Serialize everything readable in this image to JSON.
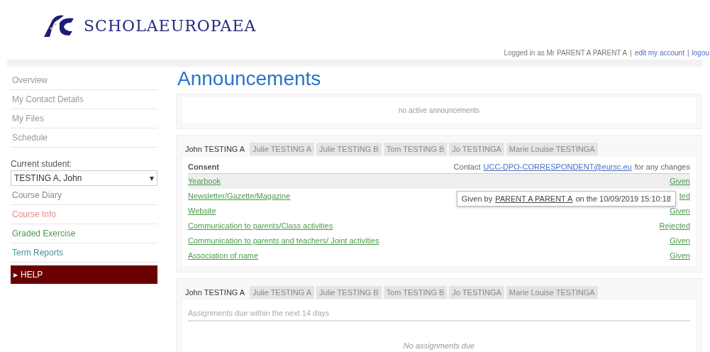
{
  "header": {
    "logo_text": "SCHOLAEUROPAEA",
    "logged_in": "Logged in as Mr PARENT A PARENT A",
    "separator_1": "|",
    "edit_account": "edit my account",
    "separator_2": "|",
    "logout": "logou"
  },
  "sidebar": {
    "items": [
      {
        "label": "Overview"
      },
      {
        "label": "My Contact Details"
      },
      {
        "label": "My Files"
      },
      {
        "label": "Schedule"
      }
    ],
    "student_label": "Current student:",
    "student_select": {
      "value": "TESTING A, John",
      "arrow": "▾"
    },
    "student_items": [
      {
        "label": "Course Diary",
        "color": "#8a8a8a"
      },
      {
        "label": "Course Info",
        "color": "#e88a8a"
      },
      {
        "label": "Graded Exercise",
        "color": "#4c9a4c"
      },
      {
        "label": "Term Reports",
        "color": "#4a8fa0"
      }
    ],
    "help": {
      "arrow": "▸",
      "label": "HELP"
    }
  },
  "page_title": "Announcements",
  "announcements": {
    "empty_text": "no active announcements"
  },
  "consent_panel": {
    "tabs": [
      {
        "label": "John TESTING A",
        "selected": true
      },
      {
        "label": "Julie TESTING A",
        "selected": false
      },
      {
        "label": "Julie TESTING B",
        "selected": false
      },
      {
        "label": "Tom TESTING B",
        "selected": false
      },
      {
        "label": "Jo TESTINGA",
        "selected": false
      },
      {
        "label": "Marie Louise TESTINGA",
        "selected": false
      }
    ],
    "heading": "Consent",
    "contact_prefix": "Contact",
    "contact_email": "UCC-DPO-CORRESPONDENT@eursc.eu",
    "contact_suffix": "for any changes",
    "rows": [
      {
        "item": "Yearbook",
        "status": "Given",
        "highlighted": true
      },
      {
        "item": "Newsletter/Gazette/Magazine",
        "status": "ted",
        "highlighted": false
      },
      {
        "item": "Website",
        "status": "Given",
        "highlighted": false
      },
      {
        "item": "Communication to parents/Class activities",
        "status": "Rejected",
        "highlighted": false
      },
      {
        "item": "Communication to parents and teachers/ Joint activities",
        "status": "Given",
        "highlighted": false
      },
      {
        "item": "Association of name",
        "status": "Given",
        "highlighted": false
      }
    ],
    "tooltip": {
      "prefix": "Given by",
      "name": "PARENT A  PARENT A",
      "suffix": "on the 10/09/2019 15:10:18"
    }
  },
  "assignments_panel": {
    "tabs": [
      {
        "label": "John TESTING A",
        "selected": true
      },
      {
        "label": "Julie TESTING A",
        "selected": false
      },
      {
        "label": "Julie TESTING B",
        "selected": false
      },
      {
        "label": "Tom TESTING B",
        "selected": false
      },
      {
        "label": "Jo TESTINGA",
        "selected": false
      },
      {
        "label": "Marie Louise TESTINGA",
        "selected": false
      }
    ],
    "heading": "Assignments due within the next 14 days",
    "empty_text": "No assignments due"
  }
}
